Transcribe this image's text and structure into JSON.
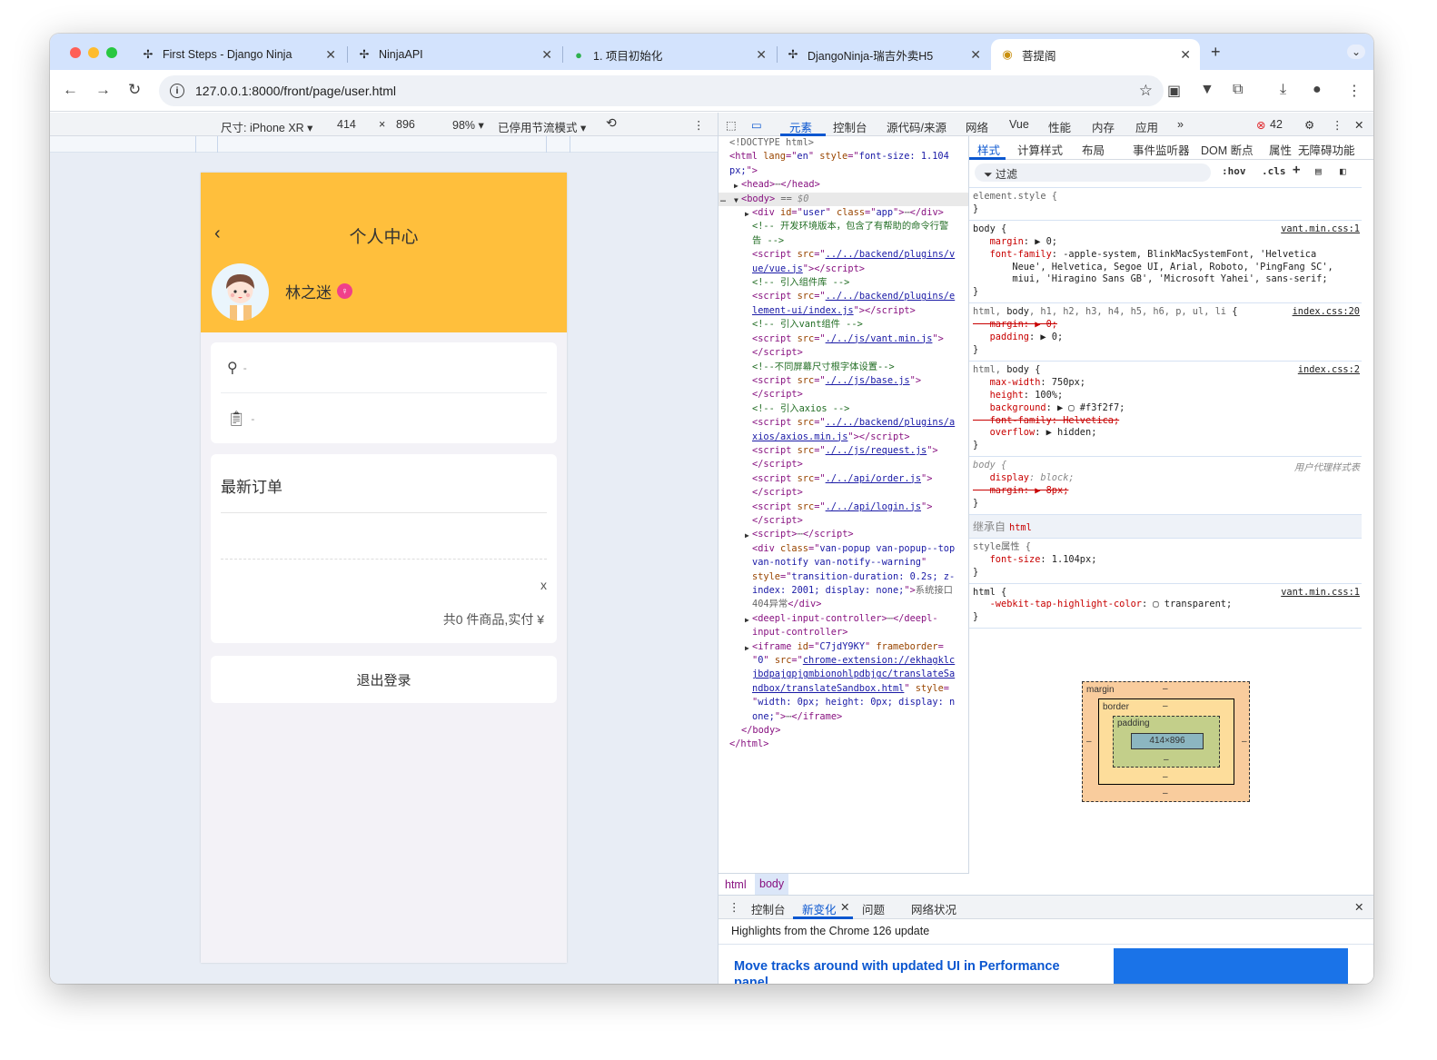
{
  "browser": {
    "tabs": [
      {
        "title": "First Steps - Django Ninja",
        "icon": "ninja-icon"
      },
      {
        "title": "NinjaAPI",
        "icon": "ninja-icon"
      },
      {
        "title": "1. 项目初始化",
        "icon": "leaf-icon"
      },
      {
        "title": "DjangoNinja-瑞吉外卖H5",
        "icon": "ninja-icon"
      },
      {
        "title": "菩提阁",
        "icon": "site-icon",
        "active": true
      }
    ],
    "new_tab": "+",
    "url": "127.0.0.1:8000/front/page/user.html"
  },
  "device_toolbar": {
    "device": "尺寸: iPhone XR ▾",
    "width": "414",
    "times": "×",
    "height": "896",
    "zoom": "98% ▾",
    "throttle": "已停用节流模式 ▾",
    "more": "⋮"
  },
  "page": {
    "title": "个人中心",
    "back": "‹",
    "user_name": "林之迷",
    "gender_icon": "♀",
    "address": "-",
    "orders_link": "-",
    "latest_orders": "最新订单",
    "close": "x",
    "summary": "共0 件商品,实付 ¥",
    "logout": "退出登录"
  },
  "devtools": {
    "tabs": [
      "元素",
      "控制台",
      "源代码/来源",
      "网络",
      "Vue",
      "性能",
      "内存",
      "应用"
    ],
    "more_tabs": "»",
    "error_count": "42",
    "elements": [
      {
        "d": 0,
        "s": [
          [
            "gr",
            "<!DOCTYPE html>"
          ]
        ]
      },
      {
        "d": 0,
        "s": [
          [
            "tg",
            "<html "
          ],
          [
            "an",
            "lang"
          ],
          [
            "tg",
            "=\""
          ],
          [
            "av",
            "en"
          ],
          [
            "tg",
            "\" "
          ],
          [
            "an",
            "style"
          ],
          [
            "tg",
            "=\""
          ],
          [
            "av",
            "font-size: 1.104"
          ]
        ]
      },
      {
        "d": 0,
        "s": [
          [
            "av",
            "px;"
          ],
          [
            "tg",
            "\">"
          ]
        ]
      },
      {
        "d": 1,
        "a": "▶",
        "s": [
          [
            "tg",
            "<head>"
          ],
          [
            "gr",
            "⋯"
          ],
          [
            "tg",
            "</head>"
          ]
        ]
      },
      {
        "d": 1,
        "a": "▼",
        "sel": true,
        "s": [
          [
            "tg",
            "<body>"
          ],
          [
            "gr",
            " == "
          ],
          [
            "mu",
            "$0"
          ]
        ]
      },
      {
        "d": 2,
        "a": "▶",
        "s": [
          [
            "tg",
            "<div "
          ],
          [
            "an",
            "id"
          ],
          [
            "tg",
            "=\""
          ],
          [
            "av",
            "user"
          ],
          [
            "tg",
            "\" "
          ],
          [
            "an",
            "class"
          ],
          [
            "tg",
            "=\""
          ],
          [
            "av",
            "app"
          ],
          [
            "tg",
            "\">"
          ],
          [
            "gr",
            "⋯"
          ],
          [
            "tg",
            "</div>"
          ]
        ]
      },
      {
        "d": 2,
        "s": [
          [
            "cm",
            "<!-- 开发环境版本，包含了有帮助的命令行警"
          ]
        ]
      },
      {
        "d": 2,
        "s": [
          [
            "cm",
            "告 -->"
          ]
        ]
      },
      {
        "d": 2,
        "s": [
          [
            "tg",
            "<script "
          ],
          [
            "an",
            "src"
          ],
          [
            "tg",
            "=\""
          ],
          [
            "lk",
            "../../backend/plugins/v"
          ]
        ]
      },
      {
        "d": 2,
        "s": [
          [
            "lk",
            "ue/vue.js"
          ],
          [
            "tg",
            "\"></script>"
          ]
        ]
      },
      {
        "d": 2,
        "s": [
          [
            "cm",
            "<!-- 引入组件库 -->"
          ]
        ]
      },
      {
        "d": 2,
        "s": [
          [
            "tg",
            "<script "
          ],
          [
            "an",
            "src"
          ],
          [
            "tg",
            "=\""
          ],
          [
            "lk",
            "../../backend/plugins/e"
          ]
        ]
      },
      {
        "d": 2,
        "s": [
          [
            "lk",
            "lement-ui/index.js"
          ],
          [
            "tg",
            "\"></script>"
          ]
        ]
      },
      {
        "d": 2,
        "s": [
          [
            "cm",
            "<!-- 引入vant组件 -->"
          ]
        ]
      },
      {
        "d": 2,
        "s": [
          [
            "tg",
            "<script "
          ],
          [
            "an",
            "src"
          ],
          [
            "tg",
            "=\""
          ],
          [
            "lk",
            "./../js/vant.min.js"
          ],
          [
            "tg",
            "\">"
          ]
        ]
      },
      {
        "d": 2,
        "s": [
          [
            "tg",
            "</script>"
          ]
        ]
      },
      {
        "d": 2,
        "s": [
          [
            "cm",
            "<!--不同屏幕尺寸根字体设置-->"
          ]
        ]
      },
      {
        "d": 2,
        "s": [
          [
            "tg",
            "<script "
          ],
          [
            "an",
            "src"
          ],
          [
            "tg",
            "=\""
          ],
          [
            "lk",
            "./../js/base.js"
          ],
          [
            "tg",
            "\">"
          ]
        ]
      },
      {
        "d": 2,
        "s": [
          [
            "tg",
            "</script>"
          ]
        ]
      },
      {
        "d": 2,
        "s": [
          [
            "cm",
            "<!-- 引入axios -->"
          ]
        ]
      },
      {
        "d": 2,
        "s": [
          [
            "tg",
            "<script "
          ],
          [
            "an",
            "src"
          ],
          [
            "tg",
            "=\""
          ],
          [
            "lk",
            "../../backend/plugins/a"
          ]
        ]
      },
      {
        "d": 2,
        "s": [
          [
            "lk",
            "xios/axios.min.js"
          ],
          [
            "tg",
            "\"></script>"
          ]
        ]
      },
      {
        "d": 2,
        "s": [
          [
            "tg",
            "<script "
          ],
          [
            "an",
            "src"
          ],
          [
            "tg",
            "=\""
          ],
          [
            "lk",
            "./../js/request.js"
          ],
          [
            "tg",
            "\">"
          ]
        ]
      },
      {
        "d": 2,
        "s": [
          [
            "tg",
            "</script>"
          ]
        ]
      },
      {
        "d": 2,
        "s": [
          [
            "tg",
            "<script "
          ],
          [
            "an",
            "src"
          ],
          [
            "tg",
            "=\""
          ],
          [
            "lk",
            "./../api/order.js"
          ],
          [
            "tg",
            "\">"
          ]
        ]
      },
      {
        "d": 2,
        "s": [
          [
            "tg",
            "</script>"
          ]
        ]
      },
      {
        "d": 2,
        "s": [
          [
            "tg",
            "<script "
          ],
          [
            "an",
            "src"
          ],
          [
            "tg",
            "=\""
          ],
          [
            "lk",
            "./../api/login.js"
          ],
          [
            "tg",
            "\">"
          ]
        ]
      },
      {
        "d": 2,
        "s": [
          [
            "tg",
            "</script>"
          ]
        ]
      },
      {
        "d": 2,
        "a": "▶",
        "s": [
          [
            "tg",
            "<script>"
          ],
          [
            "gr",
            "⋯"
          ],
          [
            "tg",
            "</script>"
          ]
        ]
      },
      {
        "d": 2,
        "s": [
          [
            "tg",
            "<div "
          ],
          [
            "an",
            "class"
          ],
          [
            "tg",
            "=\""
          ],
          [
            "av",
            "van-popup van-popup--top"
          ]
        ]
      },
      {
        "d": 2,
        "s": [
          [
            "av",
            "van-notify van-notify--warning"
          ],
          [
            "tg",
            "\""
          ]
        ]
      },
      {
        "d": 2,
        "s": [
          [
            "an",
            "style"
          ],
          [
            "tg",
            "=\""
          ],
          [
            "av",
            "transition-duration: 0.2s; z-"
          ]
        ]
      },
      {
        "d": 2,
        "s": [
          [
            "av",
            "index: 2001; display: none;"
          ],
          [
            "tg",
            "\">"
          ],
          [
            "gr",
            "系统接口"
          ]
        ]
      },
      {
        "d": 2,
        "s": [
          [
            "gr",
            "404异常"
          ],
          [
            "tg",
            "</div>"
          ]
        ]
      },
      {
        "d": 2,
        "a": "▶",
        "s": [
          [
            "tg",
            "<deepl-input-controller>"
          ],
          [
            "gr",
            "⋯"
          ],
          [
            "tg",
            "</deepl-"
          ]
        ]
      },
      {
        "d": 2,
        "s": [
          [
            "tg",
            "input-controller>"
          ]
        ]
      },
      {
        "d": 2,
        "a": "▶",
        "s": [
          [
            "tg",
            "<iframe "
          ],
          [
            "an",
            "id"
          ],
          [
            "tg",
            "=\""
          ],
          [
            "av",
            "C7jdY9KY"
          ],
          [
            "tg",
            "\" "
          ],
          [
            "an",
            "frameborder"
          ],
          [
            "tg",
            "="
          ]
        ]
      },
      {
        "d": 2,
        "s": [
          [
            "tg",
            "\""
          ],
          [
            "av",
            "0"
          ],
          [
            "tg",
            "\" "
          ],
          [
            "an",
            "src"
          ],
          [
            "tg",
            "=\""
          ],
          [
            "lk",
            "chrome-extension://ekhagklc"
          ]
        ]
      },
      {
        "d": 2,
        "s": [
          [
            "lk",
            "jbdpajgpjgmbionohlpdbjgc/translateSa"
          ]
        ]
      },
      {
        "d": 2,
        "s": [
          [
            "lk",
            "ndbox/translateSandbox.html"
          ],
          [
            "tg",
            "\" "
          ],
          [
            "an",
            "style"
          ],
          [
            "tg",
            "="
          ]
        ]
      },
      {
        "d": 2,
        "s": [
          [
            "tg",
            "\""
          ],
          [
            "av",
            "width: 0px; height: 0px; display: n"
          ]
        ]
      },
      {
        "d": 2,
        "s": [
          [
            "av",
            "one;"
          ],
          [
            "tg",
            "\">"
          ],
          [
            "gr",
            "⋯"
          ],
          [
            "tg",
            "</iframe>"
          ]
        ]
      },
      {
        "d": 1,
        "s": [
          [
            "tg",
            "</body>"
          ]
        ]
      },
      {
        "d": 0,
        "s": [
          [
            "tg",
            "</html>"
          ]
        ]
      }
    ],
    "breadcrumbs": [
      "html",
      "body"
    ],
    "styles_tabs": [
      "样式",
      "计算样式",
      "布局",
      "事件监听器",
      "DOM 断点",
      "属性",
      "无障碍功能"
    ],
    "filter_placeholder": "过滤",
    "hov": ":hov",
    "cls": ".cls",
    "rules": [
      {
        "src": "",
        "lines": [
          [
            [
              "gr",
              "element.style {"
            ]
          ],
          [
            [
              "",
              "}"
            ]
          ]
        ]
      },
      {
        "src": "vant.min.css:1",
        "lines": [
          [
            [
              "",
              "body {"
            ]
          ],
          [
            [
              "pn",
              "   margin"
            ],
            [
              "",
              ": ▶ 0;"
            ]
          ],
          [
            [
              "pn",
              "   font-family"
            ],
            [
              "",
              ": -apple-system, BlinkMacSystemFont, 'Helvetica"
            ]
          ],
          [
            [
              "",
              "       Neue', Helvetica, Segoe UI, Arial, Roboto, 'PingFang SC',"
            ]
          ],
          [
            [
              "",
              "       miui, 'Hiragino Sans GB', 'Microsoft Yahei', sans-serif;"
            ]
          ],
          [
            [
              "",
              "}"
            ]
          ]
        ]
      },
      {
        "src": "index.css:20",
        "lines": [
          [
            [
              "gr",
              "html, "
            ],
            [
              "",
              "body"
            ],
            [
              "gr",
              ", h1, h2, h3, h4, h5, h6, p, ul, li "
            ],
            [
              "",
              "{"
            ]
          ],
          [
            [
              "pn strike",
              "   margin: ▶ 0;"
            ]
          ],
          [
            [
              "pn",
              "   padding"
            ],
            [
              "",
              ": ▶ 0;"
            ]
          ],
          [
            [
              "",
              "}"
            ]
          ]
        ]
      },
      {
        "src": "index.css:2",
        "lines": [
          [
            [
              "gr",
              "html, "
            ],
            [
              "",
              "body {"
            ]
          ],
          [
            [
              "pn",
              "   max-width"
            ],
            [
              "",
              ": 750px;"
            ]
          ],
          [
            [
              "pn",
              "   height"
            ],
            [
              "",
              ": 100%;"
            ]
          ],
          [
            [
              "pn",
              "   background"
            ],
            [
              "",
              ": ▶ ▢ #f3f2f7;"
            ]
          ],
          [
            [
              "pn strike",
              "   font-family: Helvetica;"
            ]
          ],
          [
            [
              "pn",
              "   overflow"
            ],
            [
              "",
              ": ▶ hidden;"
            ]
          ],
          [
            [
              "",
              "}"
            ]
          ]
        ]
      },
      {
        "src": "用户代理样式表",
        "ua": true,
        "lines": [
          [
            [
              "mu",
              "body {"
            ]
          ],
          [
            [
              "pn",
              "   display"
            ],
            [
              "mu",
              ": block;"
            ]
          ],
          [
            [
              "pn strike",
              "   margin: ▶ 8px;"
            ]
          ],
          [
            [
              "",
              "}"
            ]
          ]
        ]
      }
    ],
    "inherited_label": "继承自",
    "inherited_from": "html",
    "rules2": [
      {
        "src": "",
        "lines": [
          [
            [
              "gr",
              "style属性 {"
            ]
          ],
          [
            [
              "pn",
              "   font-size"
            ],
            [
              "",
              ": 1.104px;"
            ]
          ],
          [
            [
              "",
              "}"
            ]
          ]
        ]
      },
      {
        "src": "vant.min.css:1",
        "lines": [
          [
            [
              "",
              "html {"
            ]
          ],
          [
            [
              "pn",
              "   -webkit-tap-highlight-color"
            ],
            [
              "",
              ": ▢ transparent;"
            ]
          ],
          [
            [
              "",
              "}"
            ]
          ]
        ]
      }
    ],
    "box_model": {
      "margin": "margin",
      "border": "border",
      "padding": "padding",
      "content": "414×896",
      "dash": "–"
    },
    "drawer": {
      "tabs": [
        "控制台",
        "新变化",
        "问题",
        "网络状况"
      ],
      "highlights": "Highlights from the Chrome 126 update",
      "news_title": "Move tracks around with updated UI in Performance panel"
    }
  }
}
